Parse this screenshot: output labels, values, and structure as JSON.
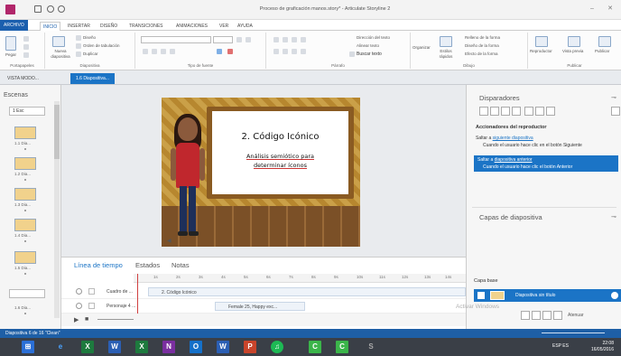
{
  "titlebar": {
    "title": "Proceso de graficación manos.story* - Articulate Storyline 2"
  },
  "ribbon_tabs": [
    "ARCHIVO",
    "INICIO",
    "INSERTAR",
    "DISEÑO",
    "TRANSICIONES",
    "ANIMACIONES",
    "VER",
    "AYUDA"
  ],
  "ribbon": {
    "groups": [
      "Portapapeles",
      "Diapositiva",
      "Tipo de fuente",
      "Párrafo",
      "Dibujo",
      "Publicar"
    ],
    "paste": "Pegar",
    "new_slide": "Nueva diapositiva",
    "design": "Diseño",
    "tab_order": "Orden de tabulación",
    "duplicate": "Duplicar",
    "text_direction": "Dirección del texto",
    "align_text": "Alinear texto",
    "find_text": "Buscar texto",
    "organize": "Organizar",
    "quick_styles": "Estilos rápidos",
    "shape_fill": "Relleno de la forma",
    "shape_outline": "Diseño de la forma",
    "shape_effects": "Efecto de la forma",
    "player": "Reproductor",
    "preview": "Vista previa",
    "publish": "Publicar"
  },
  "doc_tabs": {
    "story": "VISTA MODO...",
    "slide": "1.6 Diapositiva..."
  },
  "scenes": {
    "header": "Escenas",
    "selector": "1 Esc",
    "thumbnails": [
      "1.1 Dia...",
      "1.2 Dia...",
      "1.3 Dia...",
      "1.4 Dia...",
      "1.5 Dia...",
      "1.6 Dia..."
    ]
  },
  "slide": {
    "title": "2. Código Icónico",
    "subtitle_line1": "Análisis semiótico para",
    "subtitle_line2": "determinar íconos"
  },
  "timeline": {
    "tabs": [
      "Línea de tiempo",
      "Estados",
      "Notas"
    ],
    "ruler_ticks": [
      "1s",
      "2s",
      "3s",
      "4s",
      "5s",
      "6s",
      "7s",
      "8s",
      "9s",
      "10s",
      "11s",
      "12s",
      "13s",
      "14s"
    ],
    "rows": [
      {
        "name": "Cuadro de ...",
        "bar": "2. Código Icónico"
      },
      {
        "name": "Personaje 4 ...",
        "bar": "Female 25, Happy exc..."
      }
    ]
  },
  "triggers": {
    "header": "Disparadores",
    "player_triggers": "Accionadores del reproductor",
    "t1_pre": "Saltar a",
    "t1_link": "siguiente diapositiva",
    "t1_desc": "Cuando el usuario hace clic en el botón Siguiente",
    "t2_pre": "Saltar a",
    "t2_link": "diapositiva anterior",
    "t2_desc": "Cuando el usuario hace clic el botón Anterior"
  },
  "layers": {
    "header": "Capas de diapositiva",
    "base": "Capa base",
    "row_name": "Diapositiva sin título",
    "hide_label": "Atenuar"
  },
  "watermark": "Activar Windows",
  "status": {
    "left": "Diapositiva 6 de 16   \"Clean\""
  },
  "taskbar": {
    "apps": [
      "e",
      "X",
      "W",
      "X",
      "N",
      "O",
      "W",
      "P",
      "♫",
      "C",
      "C",
      "S"
    ],
    "time": "22:08",
    "date": "16/05/2016",
    "lang": "ESP ES"
  },
  "colors": {
    "accent": "#1b74c6",
    "storyline": "#b1266a",
    "taskbar": "#3a3f47"
  }
}
